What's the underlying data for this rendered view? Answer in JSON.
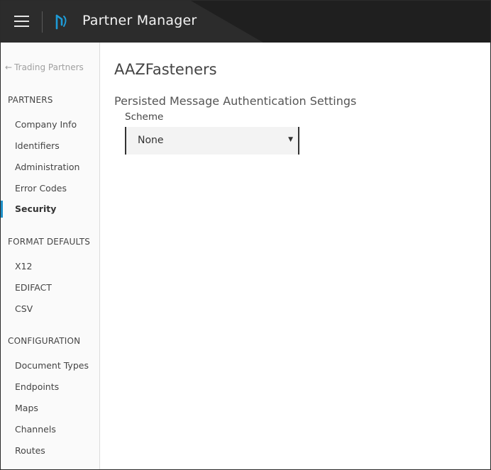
{
  "header": {
    "menu_icon": "hamburger-menu-icon",
    "logo_icon": "partner-manager-logo-icon",
    "app_title": "Partner Manager",
    "background_color": "#1f1f1f"
  },
  "sidebar": {
    "back_link": {
      "icon": "arrow-left-icon",
      "arrow": "←",
      "label": "Trading Partners"
    },
    "sections": [
      {
        "title": "PARTNERS",
        "items": [
          {
            "label": "Company Info",
            "active": false
          },
          {
            "label": "Identifiers",
            "active": false
          },
          {
            "label": "Administration",
            "active": false
          },
          {
            "label": "Error Codes",
            "active": false
          },
          {
            "label": "Security",
            "active": true
          }
        ]
      },
      {
        "title": "FORMAT DEFAULTS",
        "items": [
          {
            "label": "X12",
            "active": false
          },
          {
            "label": "EDIFACT",
            "active": false
          },
          {
            "label": "CSV",
            "active": false
          }
        ]
      },
      {
        "title": "CONFIGURATION",
        "items": [
          {
            "label": "Document Types",
            "active": false
          },
          {
            "label": "Endpoints",
            "active": false
          },
          {
            "label": "Maps",
            "active": false
          },
          {
            "label": "Channels",
            "active": false
          },
          {
            "label": "Routes",
            "active": false
          }
        ]
      }
    ],
    "active_accent_color": "#1e90c8"
  },
  "main": {
    "page_title": "AAZFasteners",
    "section_heading": "Persisted Message Authentication Settings",
    "scheme_field": {
      "label": "Scheme",
      "selected_value": "None",
      "caret_icon": "dropdown-caret-icon",
      "caret": "▼"
    }
  }
}
